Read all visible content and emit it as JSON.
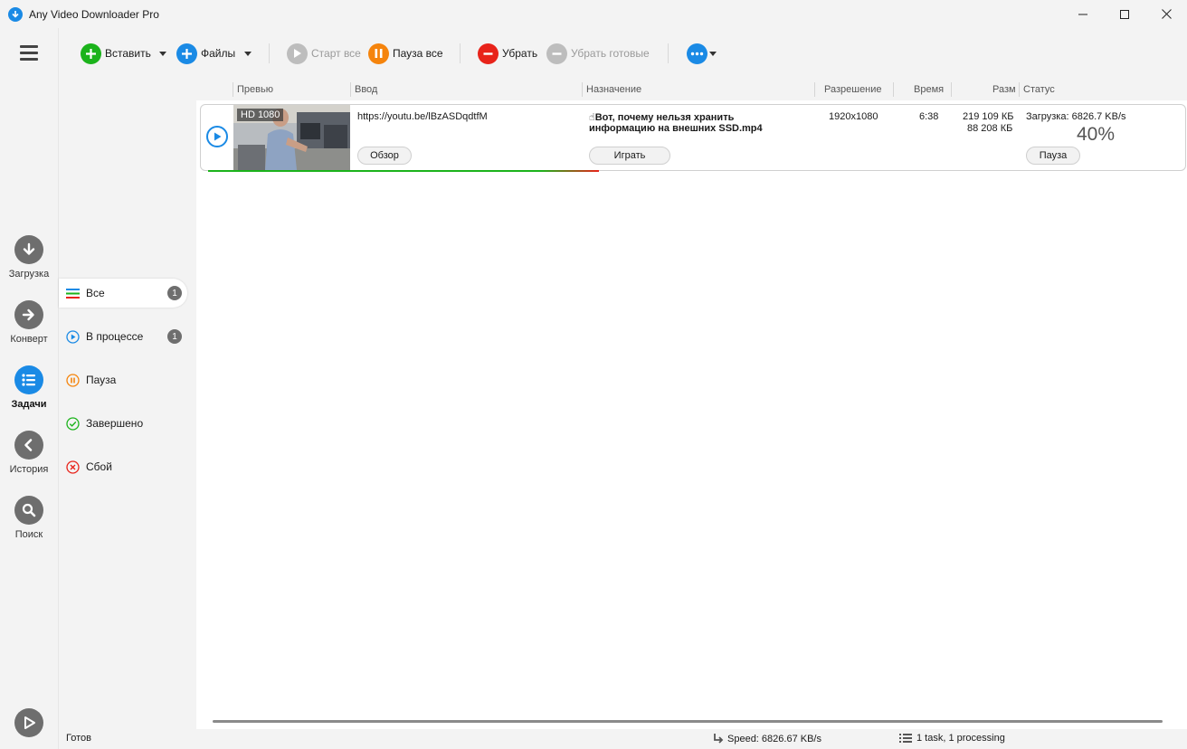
{
  "window": {
    "title": "Any Video Downloader Pro"
  },
  "nav": {
    "items": [
      {
        "label": "Загрузка",
        "icon": "download-arrow-icon"
      },
      {
        "label": "Конверт",
        "icon": "convert-arrow-icon"
      },
      {
        "label": "Задачи",
        "icon": "tasks-list-icon",
        "active": true
      },
      {
        "label": "История",
        "icon": "history-back-icon"
      },
      {
        "label": "Поиск",
        "icon": "search-icon"
      }
    ]
  },
  "toolbar": {
    "paste_label": "Вставить",
    "files_label": "Файлы",
    "start_all_label": "Старт все",
    "pause_all_label": "Пауза все",
    "remove_label": "Убрать",
    "remove_done_label": "Убрать готовые"
  },
  "filters": [
    {
      "label": "Все",
      "count": "1"
    },
    {
      "label": "В процессе",
      "count": "1"
    },
    {
      "label": "Пауза"
    },
    {
      "label": "Завершено"
    },
    {
      "label": "Сбой"
    }
  ],
  "table": {
    "columns": {
      "preview": "Превью",
      "input": "Ввод",
      "destination": "Назначение",
      "resolution": "Разрешение",
      "time": "Время",
      "size": "Разм",
      "status": "Статус"
    },
    "rows": [
      {
        "quality_badge": "HD 1080",
        "url": "https://youtu.be/lBzASDqdtfM",
        "browse_label": "Обзор",
        "filename_line1": "☝Вот, почему нельзя хранить",
        "filename_line2": "информацию на внешних SSD.mp4",
        "play_label": "Играть",
        "resolution": "1920x1080",
        "duration": "6:38",
        "size_total": "219 109 КБ",
        "size_done": "88 208 КБ",
        "status_text": "Загрузка: 6826.7 KB/s",
        "percent": "40%",
        "progress_fraction": 0.4,
        "pause_label": "Пауза"
      }
    ]
  },
  "statusbar": {
    "state": "Готов",
    "speed": "Speed: 6826.67 KB/s",
    "tasks": "1 task, 1 processing"
  },
  "colors": {
    "accent": "#1a8ae5",
    "green": "#1bb31b",
    "red": "#e8231a",
    "orange": "#f5840c",
    "gray_icon": "#6e6e6e"
  }
}
